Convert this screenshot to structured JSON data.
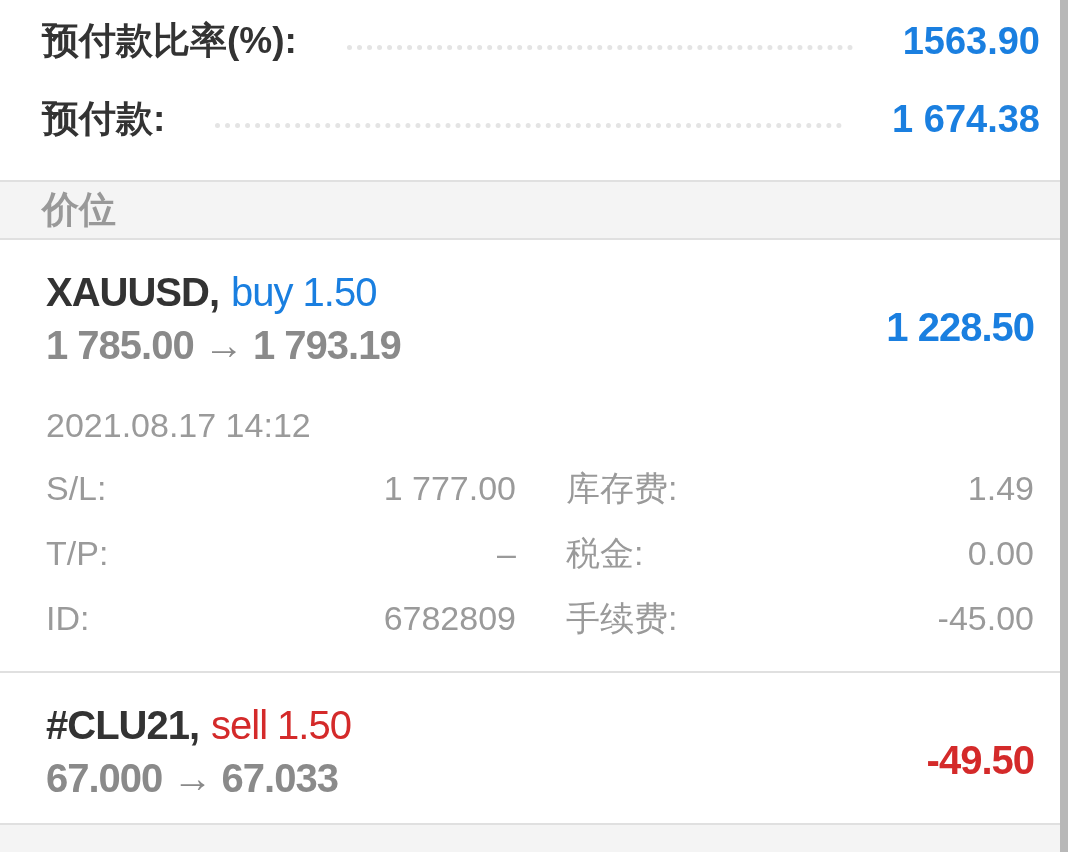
{
  "summary": [
    {
      "label": "预付款比率(%):",
      "value": "1563.90"
    },
    {
      "label": "预付款:",
      "value": "1 674.38"
    }
  ],
  "section": {
    "title": "价位"
  },
  "positions": [
    {
      "symbol": "XAUUSD,",
      "type": "buy",
      "volume": "1.50",
      "prices": "1 785.00 → 1 793.19",
      "profit": "1 228.50",
      "expanded": true,
      "time": "2021.08.17 14:12",
      "details": [
        {
          "label": "S/L:",
          "value": "1 777.00",
          "label2": "库存费:",
          "value2": "1.49"
        },
        {
          "label": "T/P:",
          "value": "–",
          "label2": "税金:",
          "value2": "0.00"
        },
        {
          "label": "ID:",
          "value": "6782809",
          "label2": "手续费:",
          "value2": "-45.00"
        }
      ]
    },
    {
      "symbol": "#CLU21,",
      "type": "sell",
      "volume": "1.50",
      "prices": "67.000 → 67.033",
      "profit": "-49.50",
      "expanded": false
    }
  ]
}
